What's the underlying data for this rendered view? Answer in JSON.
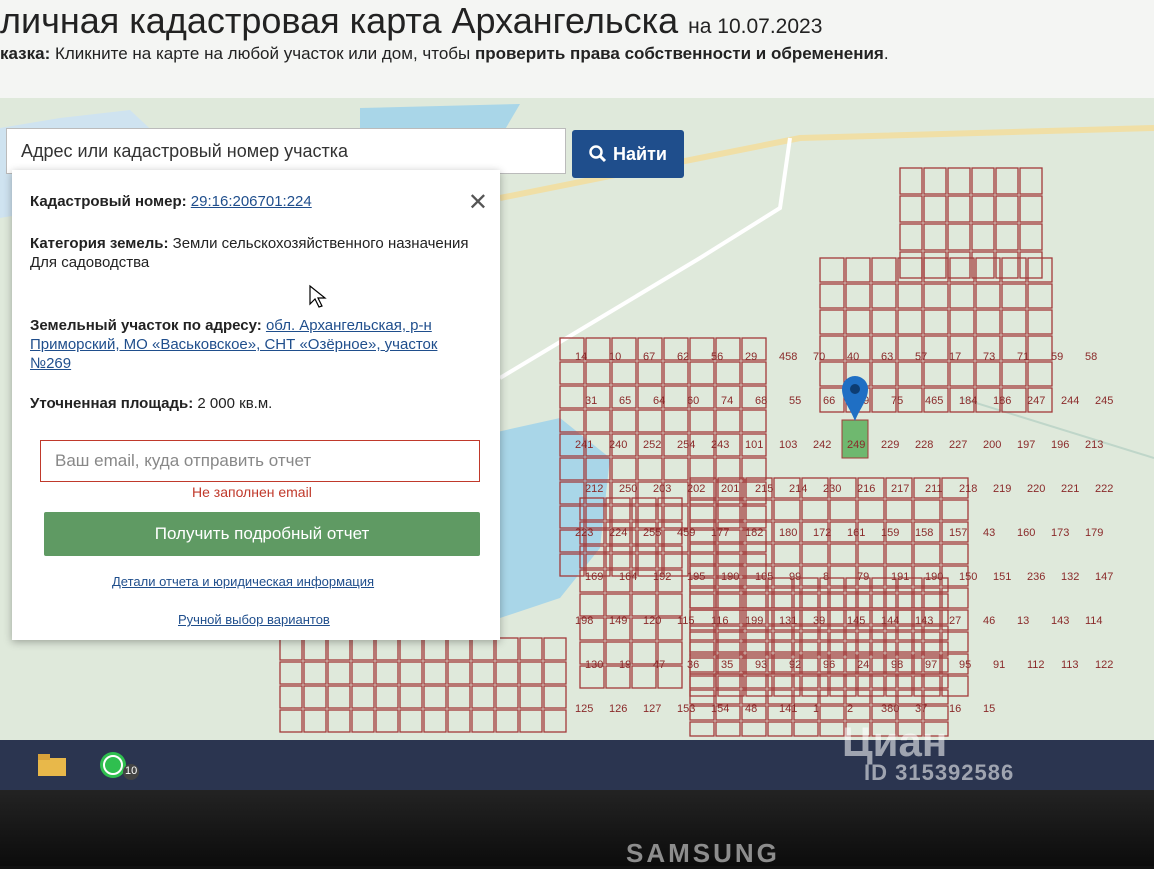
{
  "header": {
    "title": "личная кадастровая карта Архангельска",
    "date": "на 10.07.2023",
    "hint_prefix": "казка:",
    "hint_text": "Кликните на карте на любой участок или дом, чтобы",
    "hint_bold": "проверить права собственности и обременения",
    "hint_suffix": "."
  },
  "search": {
    "placeholder": "Адрес или кадастровый номер участка",
    "button_label": "Найти"
  },
  "popup": {
    "cadastral_label": "Кадастровый номер:",
    "cadastral_number": "29:16:206701:224",
    "category_label": "Категория земель:",
    "category_value": "Земли сельскохозяйственного назначения",
    "use_value": "Для садоводства",
    "address_label": "Земельный участок по адресу:",
    "address_value": "обл. Архангельская, р-н Приморский, МО «Васьковское», СНТ «Озёрное», участок №269",
    "area_label": "Уточненная площадь:",
    "area_value": "2 000 кв.м.",
    "email_placeholder": "Ваш email, куда отправить отчет",
    "email_error": "Не заполнен email",
    "report_button": "Получить подробный отчет",
    "details_link": "Детали отчета и юридическая информация",
    "manual_link": "Ручной выбор вариантов"
  },
  "map": {
    "plot_labels": [
      "14",
      "10",
      "67",
      "62",
      "56",
      "29",
      "458",
      "70",
      "40",
      "63",
      "57",
      "17",
      "73",
      "71",
      "59",
      "58",
      "31",
      "65",
      "64",
      "60",
      "74",
      "68",
      "55",
      "66",
      "69",
      "75",
      "465",
      "184",
      "186",
      "247",
      "244",
      "245",
      "241",
      "240",
      "252",
      "254",
      "243",
      "101",
      "103",
      "242",
      "249",
      "229",
      "228",
      "227",
      "200",
      "197",
      "196",
      "213",
      "212",
      "250",
      "203",
      "202",
      "201",
      "215",
      "214",
      "230",
      "216",
      "217",
      "211",
      "218",
      "219",
      "220",
      "221",
      "222",
      "223",
      "224",
      "255",
      "459",
      "177",
      "182",
      "180",
      "172",
      "161",
      "159",
      "158",
      "157",
      "43",
      "160",
      "173",
      "179",
      "169",
      "164",
      "192",
      "195",
      "190",
      "105",
      "99",
      "8",
      "79",
      "191",
      "190",
      "150",
      "151",
      "236",
      "132",
      "147",
      "198",
      "149",
      "120",
      "115",
      "116",
      "199",
      "131",
      "39",
      "145",
      "144",
      "143",
      "27",
      "46",
      "13",
      "143",
      "114",
      "130",
      "19",
      "47",
      "36",
      "35",
      "93",
      "92",
      "96",
      "24",
      "98",
      "97",
      "95",
      "91",
      "112",
      "113",
      "122",
      "125",
      "126",
      "127",
      "153",
      "154",
      "48",
      "141",
      "1",
      "2",
      "380",
      "37",
      "16",
      "15"
    ],
    "selected_plot": "224"
  },
  "taskbar": {
    "whatsapp_badge": "10"
  },
  "watermark": {
    "logo": "Циан",
    "id": "ID 315392586"
  },
  "bezel": {
    "brand": "SAMSUNG"
  },
  "colors": {
    "primary_button": "#1f4e8c",
    "report_button": "#5f9a63",
    "plot_stroke": "#a33a3a",
    "selected_plot": "#6fb86f",
    "map_background": "#dfe9db",
    "water": "#a9d6e8"
  }
}
